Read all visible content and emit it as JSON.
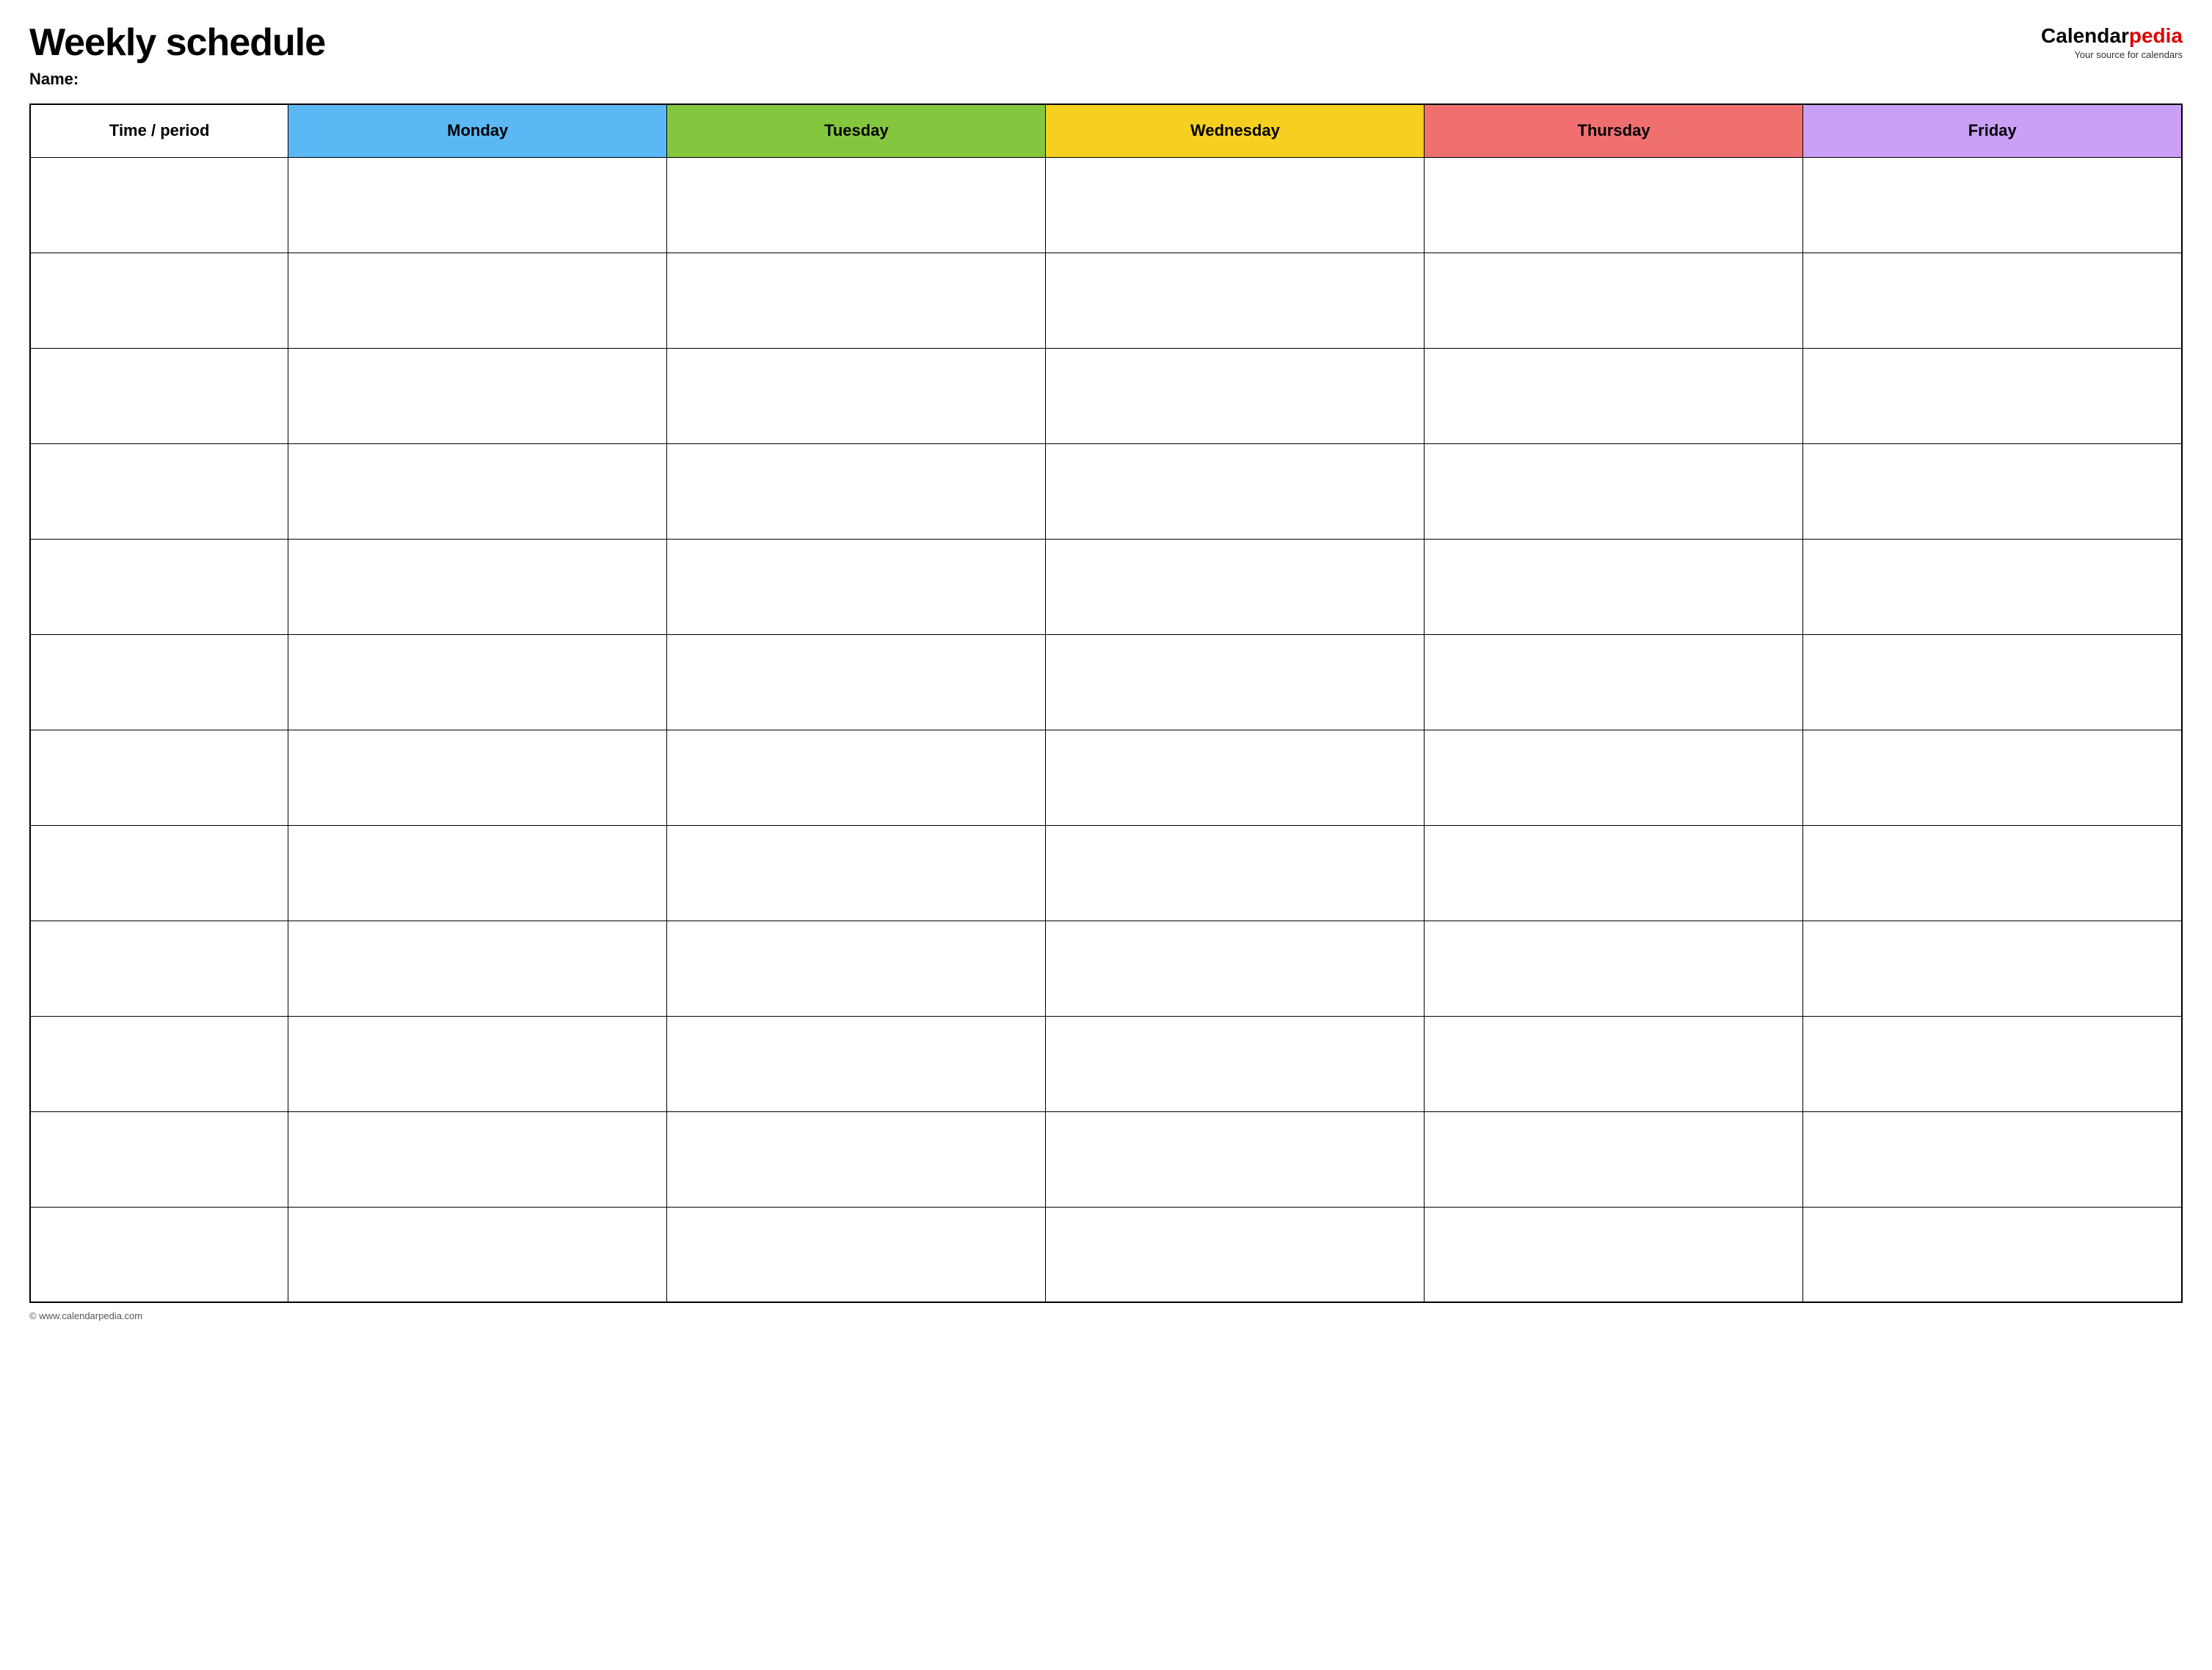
{
  "header": {
    "title": "Weekly schedule",
    "name_label": "Name:",
    "logo_calendar": "Calendar",
    "logo_pedia": "pedia",
    "logo_tagline": "Your source for calendars"
  },
  "table": {
    "columns": [
      {
        "id": "time",
        "label": "Time / period",
        "color": "#ffffff",
        "class": "header-time"
      },
      {
        "id": "monday",
        "label": "Monday",
        "color": "#5bb8f5",
        "class": "header-monday"
      },
      {
        "id": "tuesday",
        "label": "Tuesday",
        "color": "#84c73e",
        "class": "header-tuesday"
      },
      {
        "id": "wednesday",
        "label": "Wednesday",
        "color": "#f5d020",
        "class": "header-wednesday"
      },
      {
        "id": "thursday",
        "label": "Thursday",
        "color": "#f07070",
        "class": "header-thursday"
      },
      {
        "id": "friday",
        "label": "Friday",
        "color": "#c9a0f5",
        "class": "header-friday"
      }
    ],
    "row_count": 12
  },
  "footer": {
    "url": "© www.calendarpedia.com"
  }
}
